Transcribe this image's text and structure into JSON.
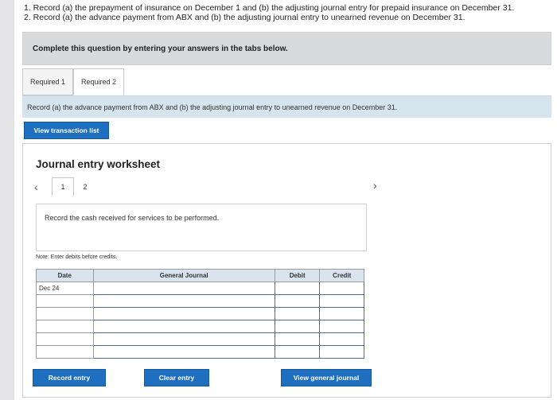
{
  "instructions": {
    "line1": "1. Record (a) the prepayment of insurance on December 1 and (b) the adjusting journal entry for prepaid insurance on December 31.",
    "line2": "2. Record (a) the advance payment from ABX and (b) the adjusting journal entry to unearned revenue on December 31."
  },
  "banner": {
    "text": "Complete this question by entering your answers in the tabs below."
  },
  "tabs": [
    {
      "label": "Required 1"
    },
    {
      "label": "Required 2"
    }
  ],
  "tab_body": {
    "text": "Record (a) the advance payment from ABX and (b) the adjusting journal entry to unearned revenue on December 31."
  },
  "view_transaction_button": "View transaction list",
  "worksheet": {
    "title": "Journal entry worksheet",
    "pages": [
      "1",
      "2"
    ],
    "prev_icon": "chevron-left",
    "next_icon": "chevron-right",
    "prompt": "Record the cash received for services to be performed.",
    "note": "Note: Enter debits before credits.",
    "columns": [
      "Date",
      "General Journal",
      "Debit",
      "Credit"
    ],
    "rows": [
      [
        "Dec 24",
        "",
        "",
        ""
      ],
      [
        "",
        "",
        "",
        ""
      ],
      [
        "",
        "",
        "",
        ""
      ],
      [
        "",
        "",
        "",
        ""
      ],
      [
        "",
        "",
        "",
        ""
      ],
      [
        "",
        "",
        "",
        ""
      ]
    ],
    "record_button": "Record entry",
    "clear_button": "Clear entry",
    "view_journal_button": "View general journal"
  }
}
